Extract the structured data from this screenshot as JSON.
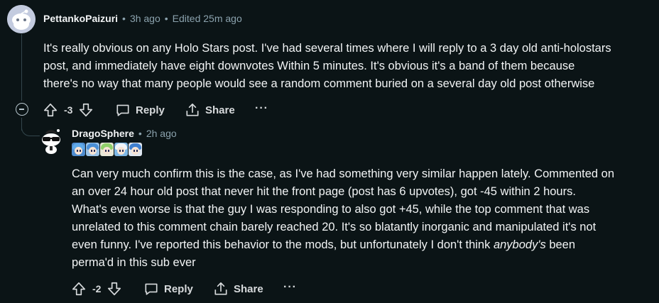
{
  "comments": [
    {
      "username": "PettankoPaizuri",
      "time": "3h ago",
      "edited": "Edited 25m ago",
      "body": [
        "It's really obvious on any Holo Stars post. I've had several times where I will reply to a 3 day old anti-holostars",
        "post, and immediately have eight downvotes Within 5 minutes. It's obvious it's a band of them because",
        "there's no way that many people would see a random comment buried on a several day old post otherwise"
      ],
      "score": "-3",
      "reply_label": "Reply",
      "share_label": "Share",
      "more_label": "···"
    },
    {
      "username": "DragoSphere",
      "time": "2h ago",
      "flair_emotes": [
        "blue-hair-emote",
        "blue-hair-emote",
        "green-hair-emote",
        "white-hair-emote",
        "blue-hair-emote"
      ],
      "body_lines": [
        "Can very much confirm this is the case, as I've had something very similar happen lately. Commented on",
        "an over 24 hour old post that never hit the front page (post has 6 upvotes), got -45 within 2 hours.",
        "What's even worse is that the guy I was responding to also got +45, while the top comment that was",
        "unrelated to this comment chain barely reached 20. It's so blatantly inorganic and manipulated it's not",
        "even funny. I've reported this behavior to the mods, but unfortunately I don't think"
      ],
      "body_italic": "anybody's",
      "body_after_italic": " been",
      "body_last": "perma'd in this sub ever",
      "score": "-2",
      "reply_label": "Reply",
      "share_label": "Share",
      "more_label": "···"
    }
  ],
  "meta_separator": "•",
  "colors": {
    "background": "#0b1416",
    "text": "#f2f4f5",
    "meta": "#8ba2ad",
    "thread_line": "#33464c"
  }
}
